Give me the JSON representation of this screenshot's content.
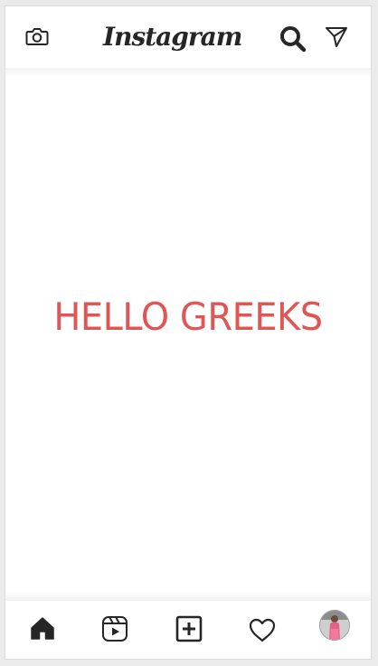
{
  "header": {
    "logo_text": "Instagram",
    "icons": [
      "camera-icon",
      "search-icon",
      "send-icon"
    ]
  },
  "main": {
    "message": "HELLO GREEKS",
    "message_color": "#e05655"
  },
  "bottom_nav": {
    "items": [
      "home-icon",
      "reels-icon",
      "add-post-icon",
      "heart-icon",
      "profile-avatar"
    ]
  }
}
